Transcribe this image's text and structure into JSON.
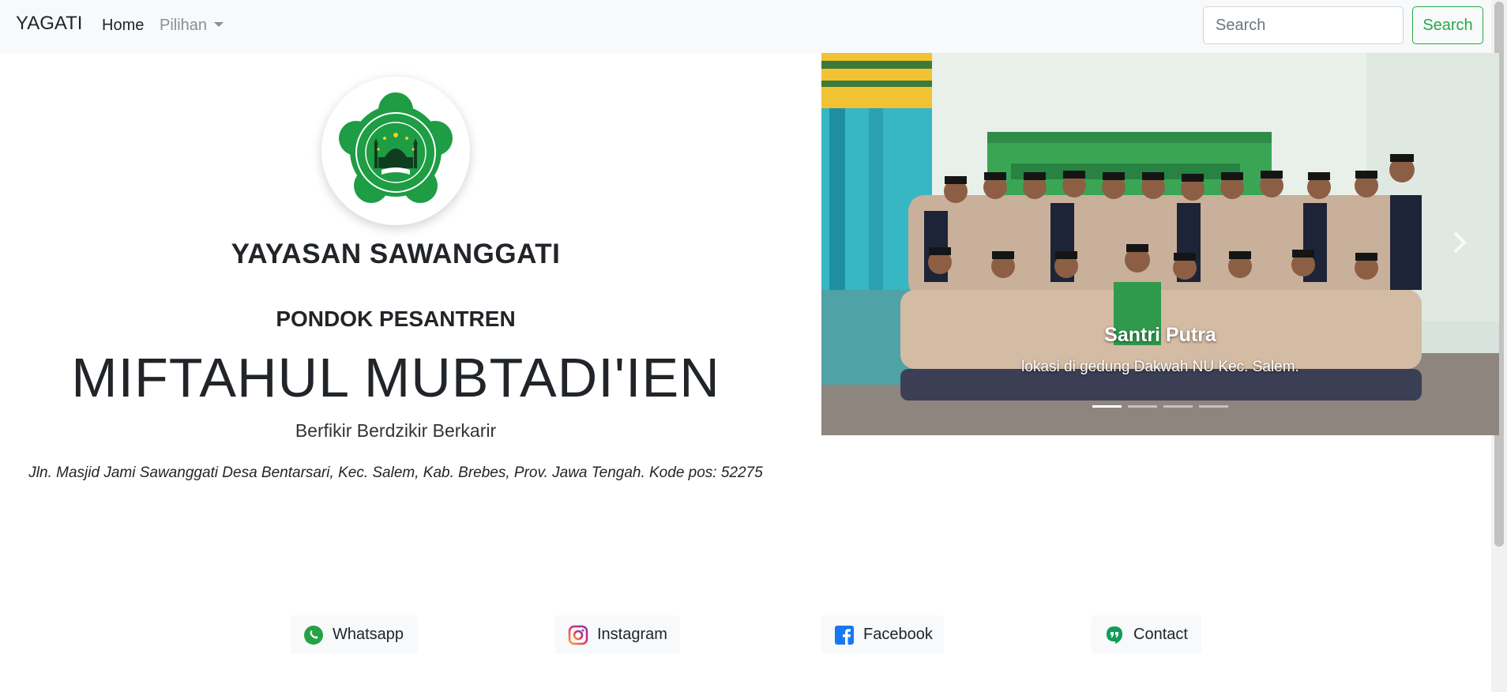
{
  "navbar": {
    "brand": "YAGATI",
    "home_label": "Home",
    "dropdown_label": "Pilihan",
    "search_placeholder": "Search",
    "search_button_label": "Search"
  },
  "hero": {
    "org_name": "YAYASAN SAWANGGATI",
    "subtitle": "PONDOK PESANTREN",
    "title": "MIFTAHUL MUBTADI'IEN",
    "tagline": "Berfikir Berdzikir Berkarir",
    "address": "Jln. Masjid Jami Sawanggati Desa Bentarsari, Kec. Salem, Kab. Brebes, Prov. Jawa Tengah. Kode pos: 52275",
    "logo_icon": "yayasan-logo-icon"
  },
  "carousel": {
    "caption_title": "Santri Putra",
    "caption_text": "lokasi di gedung Dakwah NU Kec. Salem.",
    "slide_count": 4,
    "active_index": 0,
    "next_icon": "chevron-right-icon"
  },
  "social": [
    {
      "label": "Whatsapp",
      "icon": "whatsapp-icon"
    },
    {
      "label": "Instagram",
      "icon": "instagram-icon"
    },
    {
      "label": "Facebook",
      "icon": "facebook-icon"
    },
    {
      "label": "Contact",
      "icon": "hangouts-icon"
    }
  ],
  "colors": {
    "accent_green": "#28a745",
    "navbar_bg": "#f8f9fa",
    "logo_green": "#1e9d45"
  }
}
